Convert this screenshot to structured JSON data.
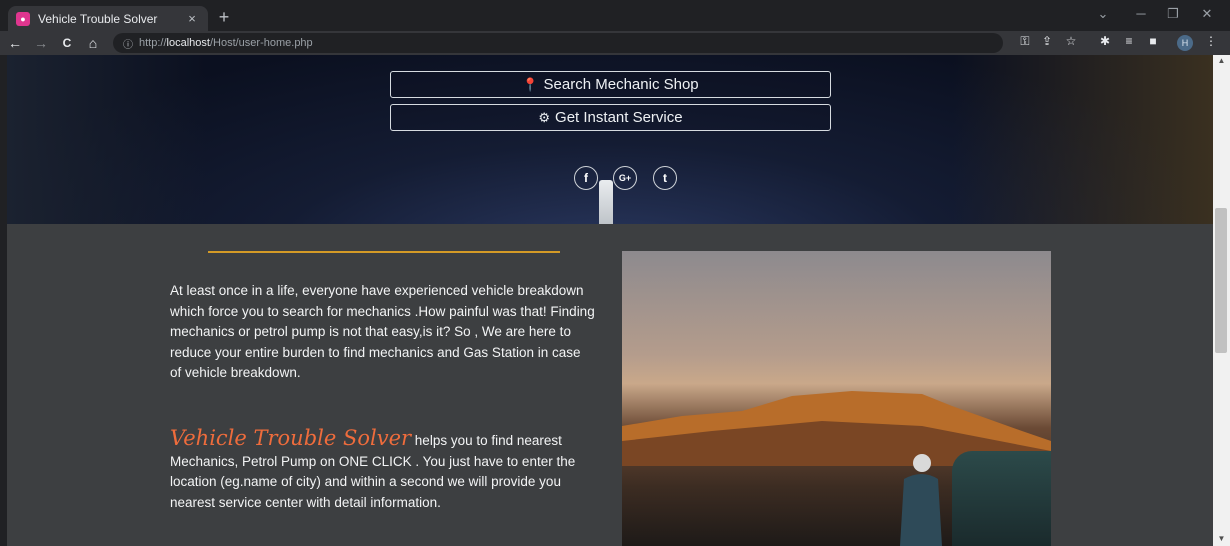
{
  "browser": {
    "tab_title": "Vehicle Trouble Solver",
    "tab_close": "×",
    "new_tab": "+",
    "url_prefix": "http://",
    "url_host": "localhost",
    "url_path": "/Host/user-home.php",
    "profile_initial": "H",
    "nav": {
      "back": "←",
      "forward": "→",
      "reload": "C",
      "home": "⌂"
    }
  },
  "hero": {
    "search_button_label": "Search Mechanic Shop",
    "search_button_icon": "map-marker-icon",
    "service_button_label": "Get Instant Service",
    "service_button_icon": "gears-icon",
    "social": [
      {
        "name": "facebook-icon",
        "glyph": "f"
      },
      {
        "name": "google-plus-icon",
        "glyph": "G+"
      },
      {
        "name": "twitter-icon",
        "glyph": "t"
      }
    ]
  },
  "content": {
    "intro": "At least once in a life, everyone have experienced vehicle breakdown which force you to search for mechanics .How painful was that! Finding mechanics or petrol pump is not that easy,is it? So , We are here to reduce your entire burden to find mechanics and Gas Station in case of vehicle breakdown.",
    "brand_name": "Vehicle Trouble Solver",
    "brand_text": " helps you to find nearest Mechanics, Petrol Pump on ONE CLICK . You just have to enter the location (eg.name of city) and within a second we will provide you nearest service center with detail information."
  },
  "colors": {
    "accent_divider": "#d49a26",
    "brand": "#ef6c3c",
    "page_background": "#3d3f41"
  }
}
